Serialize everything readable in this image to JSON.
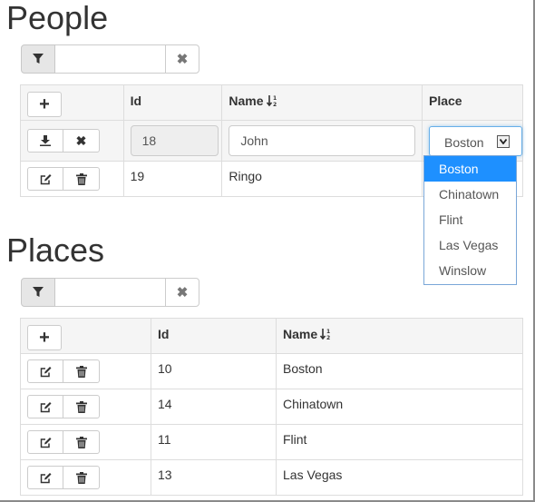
{
  "people": {
    "heading": "People",
    "filter": {
      "value": "",
      "placeholder": ""
    },
    "columns": [
      "Id",
      "Name",
      "Place"
    ],
    "edit_row": {
      "id": "18",
      "name": "John",
      "place": "Boston"
    },
    "rows": [
      {
        "id": "19",
        "name": "Ringo"
      }
    ],
    "place_options": [
      "Boston",
      "Chinatown",
      "Flint",
      "Las Vegas",
      "Winslow"
    ],
    "selected_place": "Boston"
  },
  "places": {
    "heading": "Places",
    "filter": {
      "value": "",
      "placeholder": ""
    },
    "columns": [
      "Id",
      "Name"
    ],
    "rows": [
      {
        "id": "10",
        "name": "Boston"
      },
      {
        "id": "14",
        "name": "Chinatown"
      },
      {
        "id": "11",
        "name": "Flint"
      },
      {
        "id": "13",
        "name": "Las Vegas"
      }
    ]
  },
  "icons": {
    "filter": "filter-icon",
    "clear": "x-icon",
    "add": "plus-icon",
    "save": "download-icon",
    "cancel": "x-icon",
    "edit": "edit-icon",
    "delete": "trash-icon",
    "sort": "sort-ascending-icon",
    "dropdown": "chevron-down-icon"
  },
  "colors": {
    "selection": "#1e90ff",
    "focus_border": "#66afe9",
    "header_bg": "#f5f5f5"
  }
}
